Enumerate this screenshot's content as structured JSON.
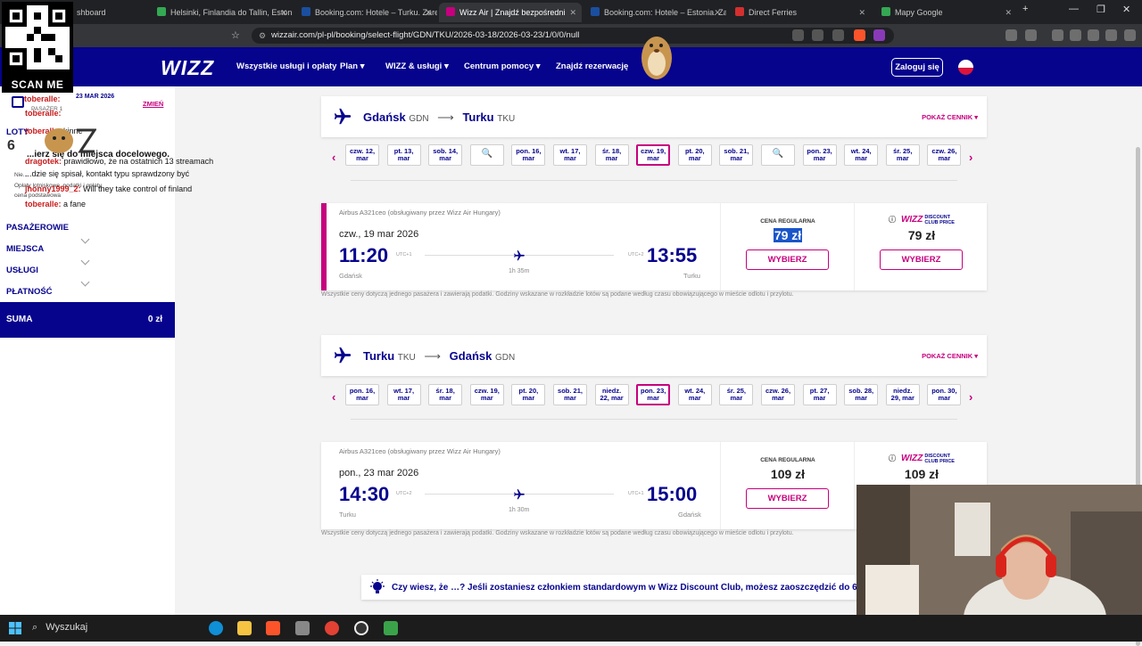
{
  "browser": {
    "tabs": [
      {
        "label": "shboard",
        "color": "#444"
      },
      {
        "label": "Helsinki, Finlandia do Tallin, Estonia",
        "color": "#34a853"
      },
      {
        "label": "Booking.com: Hotele – Turku. Zarez",
        "color": "#1a4fa0"
      },
      {
        "label": "Wizz Air | Znajdź bezpośredni",
        "color": "#c6007e"
      },
      {
        "label": "Booking.com: Hotele – Estonia. Zarez",
        "color": "#1a4fa0"
      },
      {
        "label": "Direct Ferries",
        "color": "#d32f2f"
      },
      {
        "label": "Mapy Google",
        "color": "#34a853"
      }
    ],
    "new_tab": "+",
    "url": "wizzair.com/pl-pl/booking/select-flight/GDN/TKU/2026-03-18/2026-03-23/1/0/0/null"
  },
  "nav": {
    "logo": "WIZZ",
    "items": [
      "Wszystkie usługi i opłaty",
      "Plan ▾",
      "WIZZ & usługi ▾",
      "Centrum pomocy ▾",
      "Znajdź rezerwację"
    ],
    "login": "Zaloguj się"
  },
  "overlay": {
    "scan_me": "SCAN ME",
    "chat": [
      {
        "user": "",
        "text": "23 MAR 2026"
      },
      {
        "user": "toberalle:",
        "text": ""
      },
      {
        "user": "toberalle:",
        "text": "kinne"
      },
      {
        "user": "",
        "text": "...ierz się do miejsca docelowego."
      },
      {
        "user": "dragotek:",
        "text": "prawidłowo, że na ostatnich 13 streamach"
      },
      {
        "user": "",
        "text": "...dzie się spisał, kontakt typu sprawdzony być"
      },
      {
        "user": "jhonny1999_2:",
        "text": "Will they take control of finland"
      },
      {
        "user": "toberalle:",
        "text": "a fane"
      }
    ]
  },
  "sidebar": {
    "date": "23 MAR 2026",
    "passenger": "PASAŻER 1",
    "change": "ZMIEŃ",
    "loty": "LOTY",
    "hidden_text_1": "Nie...",
    "hidden_text_2": "Opłaty lotniskowe, podatki i opłaty",
    "hidden_text_3": "cena podstawowa",
    "sections": [
      "PASAŻEROWIE",
      "MIEJSCA",
      "USŁUGI",
      "PŁATNOŚĆ"
    ],
    "sum_label": "SUMA",
    "sum_value": "0 zł"
  },
  "outbound": {
    "from": "Gdańsk",
    "from_code": "GDN",
    "to": "Turku",
    "to_code": "TKU",
    "show_prices": "POKAŻ CENNIK ▾",
    "dates": [
      [
        "czw. 12,",
        "mar"
      ],
      [
        "pt. 13,",
        "mar"
      ],
      [
        "sob. 14,",
        "mar"
      ],
      [
        "🔍",
        ""
      ],
      [
        "pon. 16,",
        "mar"
      ],
      [
        "wt. 17,",
        "mar"
      ],
      [
        "śr. 18,",
        "mar"
      ],
      [
        "czw. 19,",
        "mar"
      ],
      [
        "pt. 20,",
        "mar"
      ],
      [
        "sob. 21,",
        "mar"
      ],
      [
        "🔍",
        ""
      ],
      [
        "pon. 23,",
        "mar"
      ],
      [
        "wt. 24,",
        "mar"
      ],
      [
        "śr. 25,",
        "mar"
      ],
      [
        "czw. 26,",
        "mar"
      ]
    ],
    "selected_index": 7,
    "aircraft": "Airbus A321ceo (obsługiwany przez Wizz Air Hungary)",
    "date": "czw., 19 mar 2026",
    "dep_time": "11:20",
    "dep_utc": "UTC+1",
    "arr_time": "13:55",
    "arr_utc": "UTC+2",
    "duration": "1h 35m",
    "dep_city": "Gdańsk",
    "arr_city": "Turku",
    "regular_label": "CENA REGULARNA",
    "regular_price": "79 zł",
    "club_price": "79 zł",
    "select": "WYBIERZ",
    "fineprint": "Wszystkie ceny dotyczą jednego pasażera i zawierają podatki. Godziny wskazane w rozkładzie lotów są podane według czasu obowiązującego w mieście odlotu i przylotu."
  },
  "inbound": {
    "from": "Turku",
    "from_code": "TKU",
    "to": "Gdańsk",
    "to_code": "GDN",
    "show_prices": "POKAŻ CENNIK ▾",
    "dates": [
      [
        "pon. 16,",
        "mar"
      ],
      [
        "wt. 17,",
        "mar"
      ],
      [
        "śr. 18,",
        "mar"
      ],
      [
        "czw. 19,",
        "mar"
      ],
      [
        "pt. 20,",
        "mar"
      ],
      [
        "sob. 21,",
        "mar"
      ],
      [
        "niedz.",
        "22, mar"
      ],
      [
        "pon. 23,",
        "mar"
      ],
      [
        "wt. 24,",
        "mar"
      ],
      [
        "śr. 25,",
        "mar"
      ],
      [
        "czw. 26,",
        "mar"
      ],
      [
        "pt. 27,",
        "mar"
      ],
      [
        "sob. 28,",
        "mar"
      ],
      [
        "niedz.",
        "29, mar"
      ],
      [
        "pon. 30,",
        "mar"
      ]
    ],
    "selected_index": 7,
    "aircraft": "Airbus A321ceo (obsługiwany przez Wizz Air Hungary)",
    "date": "pon., 23 mar 2026",
    "dep_time": "14:30",
    "dep_utc": "UTC+2",
    "arr_time": "15:00",
    "arr_utc": "UTC+1",
    "duration": "1h 30m",
    "dep_city": "Turku",
    "arr_city": "Gdańsk",
    "regular_label": "CENA REGULARNA",
    "regular_price": "109 zł",
    "club_price": "109 zł",
    "select": "WYBIERZ",
    "fineprint": "Wszystkie ceny dotyczą jednego pasażera i zawierają podatki. Godziny wskazane w rozkładzie lotów są podane według czasu obowiązującego w mieście odlotu i przylotu."
  },
  "club": {
    "logo": "WIZZ",
    "line1": "DISCOUNT",
    "line2": "CLUB PRICE"
  },
  "tip": "Czy wiesz, że …? Jeśli zostaniesz członkiem standardowym w Wizz Discount Club, możesz zaoszczędzić do 60 eu",
  "taskbar": {
    "search": "Wyszukaj"
  },
  "colors": {
    "wizz_navy": "#06038d",
    "wizz_magenta": "#c6007e"
  }
}
